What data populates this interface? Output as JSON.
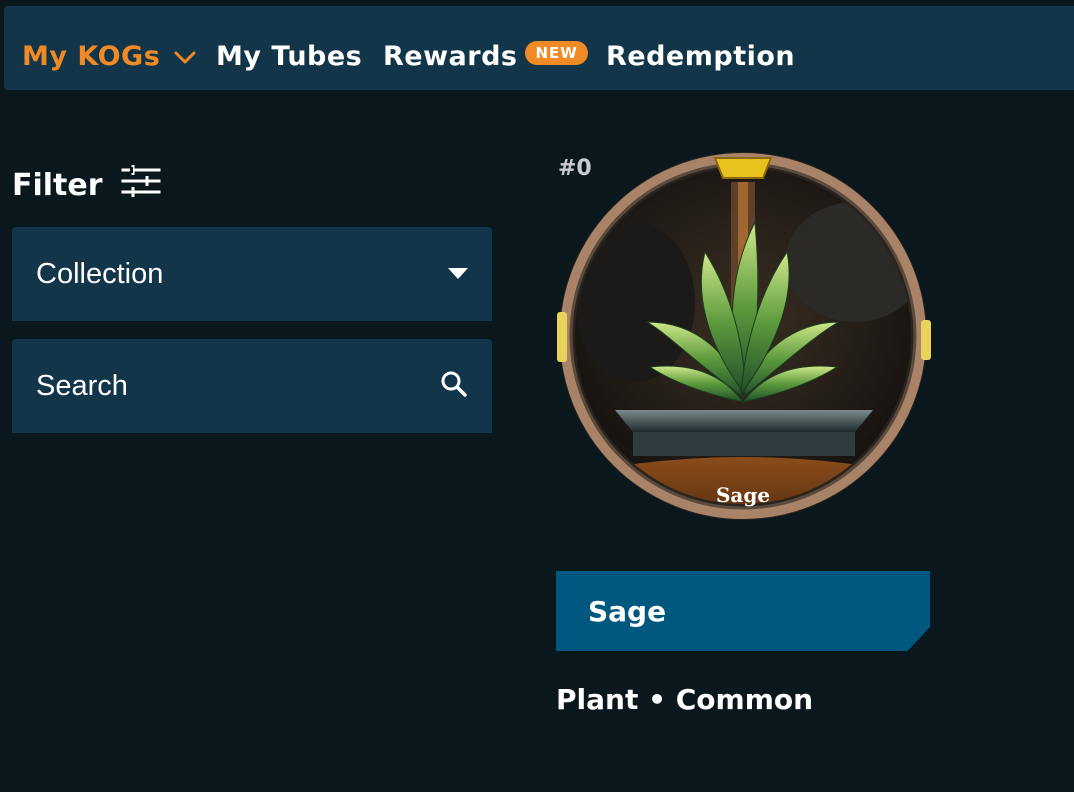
{
  "nav": {
    "my_kogs": "My KOGs",
    "my_tubes": "My Tubes",
    "rewards": "Rewards",
    "rewards_badge": "NEW",
    "redemption": "Redemption"
  },
  "filter": {
    "title": "Filter",
    "collection_label": "Collection",
    "search_label": "Search"
  },
  "card": {
    "number": "#0",
    "medal_label": "Sage",
    "name": "Sage",
    "type": "Plant",
    "separator": "•",
    "rarity": "Common"
  },
  "colors": {
    "background": "#0a171d",
    "panel": "#12354a",
    "accent": "#f08a24",
    "name_bar": "#00577f"
  },
  "icons": {
    "nav_chevron": "chevron-down-icon",
    "filter": "sliders-icon",
    "collection_caret": "caret-down-icon",
    "search": "search-icon"
  }
}
